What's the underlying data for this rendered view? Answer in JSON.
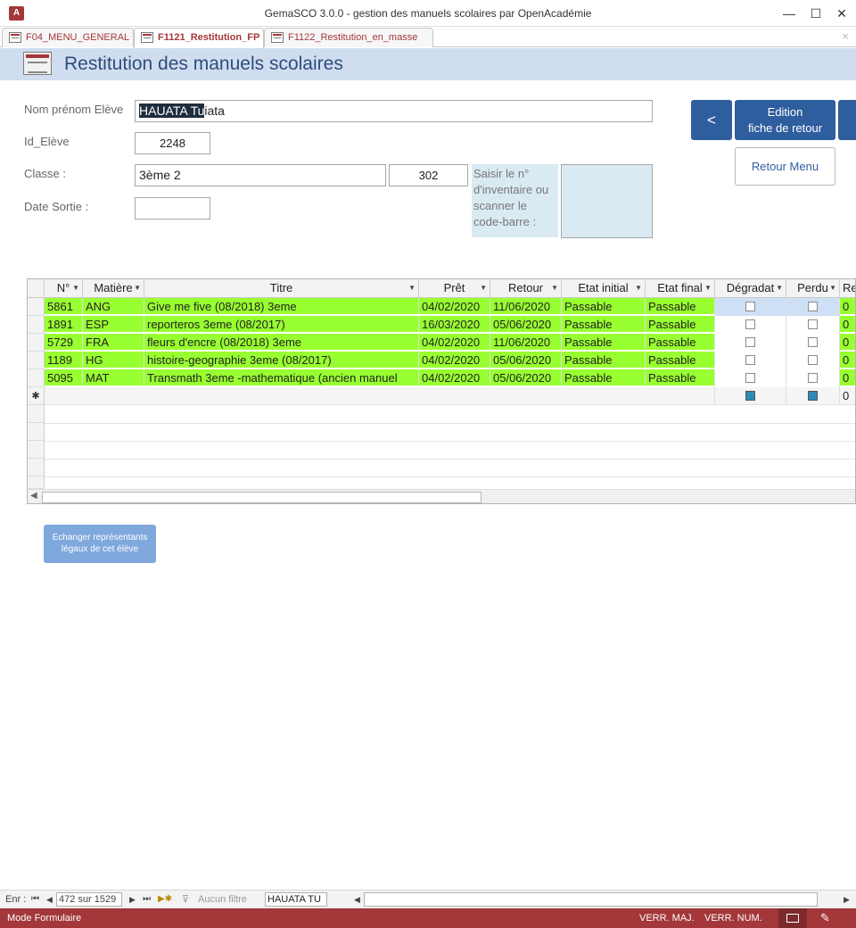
{
  "window": {
    "title": "GemaSCO 3.0.0 - gestion des manuels scolaires par OpenAcadémie",
    "app_icon": "A",
    "minimize": "—",
    "maximize": "☐",
    "close": "✕"
  },
  "tabs": [
    {
      "label": "F04_MENU_GENERAL",
      "active": false
    },
    {
      "label": "F1121_Restitution_FP",
      "active": true
    },
    {
      "label": "F1122_Restitution_en_masse",
      "active": false
    }
  ],
  "tab_close": "×",
  "form": {
    "title": "Restitution des manuels scolaires",
    "labels": {
      "nom": "Nom prénom Elève",
      "id": "Id_Elève",
      "classe": "Classe :",
      "date_sortie": "Date Sortie :",
      "scan": "Saisir le n° d'inventaire ou scanner le code-barre :"
    },
    "values": {
      "nom_selected": "HAUATA Tu",
      "nom_rest": "iata",
      "id": "2248",
      "classe": "3ème 2",
      "classe_code": "302",
      "date_sortie": ""
    },
    "buttons": {
      "prev": "<",
      "edition_line1": "Edition",
      "edition_line2": "fiche de retour",
      "retour_menu": "Retour Menu",
      "echanger_line1": "Echanger représentants",
      "echanger_line2": "légaux de cet élève"
    }
  },
  "grid": {
    "columns": [
      "N°",
      "Matière",
      "Titre",
      "Prêt",
      "Retour",
      "Etat initial",
      "Etat final",
      "Dégradat",
      "Perdu",
      "Re"
    ],
    "rows": [
      {
        "n": "5861",
        "matiere": "ANG",
        "titre": "Give me five (08/2018) 3eme",
        "pret": "04/02/2020",
        "retour": "11/06/2020",
        "etat_initial": "Passable",
        "etat_final": "Passable",
        "degrad": false,
        "perdu": false,
        "re": "0"
      },
      {
        "n": "1891",
        "matiere": "ESP",
        "titre": "reporteros 3eme (08/2017)",
        "pret": "16/03/2020",
        "retour": "05/06/2020",
        "etat_initial": "Passable",
        "etat_final": "Passable",
        "degrad": false,
        "perdu": false,
        "re": "0"
      },
      {
        "n": "5729",
        "matiere": "FRA",
        "titre": "fleurs d'encre (08/2018) 3eme",
        "pret": "04/02/2020",
        "retour": "11/06/2020",
        "etat_initial": "Passable",
        "etat_final": "Passable",
        "degrad": false,
        "perdu": false,
        "re": "0"
      },
      {
        "n": "1189",
        "matiere": "HG",
        "titre": "histoire-geographie 3eme (08/2017)",
        "pret": "04/02/2020",
        "retour": "05/06/2020",
        "etat_initial": "Passable",
        "etat_final": "Passable",
        "degrad": false,
        "perdu": false,
        "re": "0"
      },
      {
        "n": "5095",
        "matiere": "MAT",
        "titre": "Transmath 3eme -mathematique (ancien manuel",
        "pret": "04/02/2020",
        "retour": "05/06/2020",
        "etat_initial": "Passable",
        "etat_final": "Passable",
        "degrad": false,
        "perdu": false,
        "re": "0"
      }
    ],
    "new_row_marker": "✱",
    "new_row_re": "0",
    "row_color": "#98ff30"
  },
  "recnav": {
    "label": "Enr :",
    "position": "472 sur 1529",
    "filter": "Aucun filtre",
    "search": "HAUATA TU"
  },
  "statusbar": {
    "mode": "Mode Formulaire",
    "caps": "VERR. MAJ.",
    "num": "VERR. NUM."
  },
  "colors": {
    "accent": "#a4373a",
    "header_band": "#d0ddf0",
    "nav_button": "#2f5e9e"
  }
}
